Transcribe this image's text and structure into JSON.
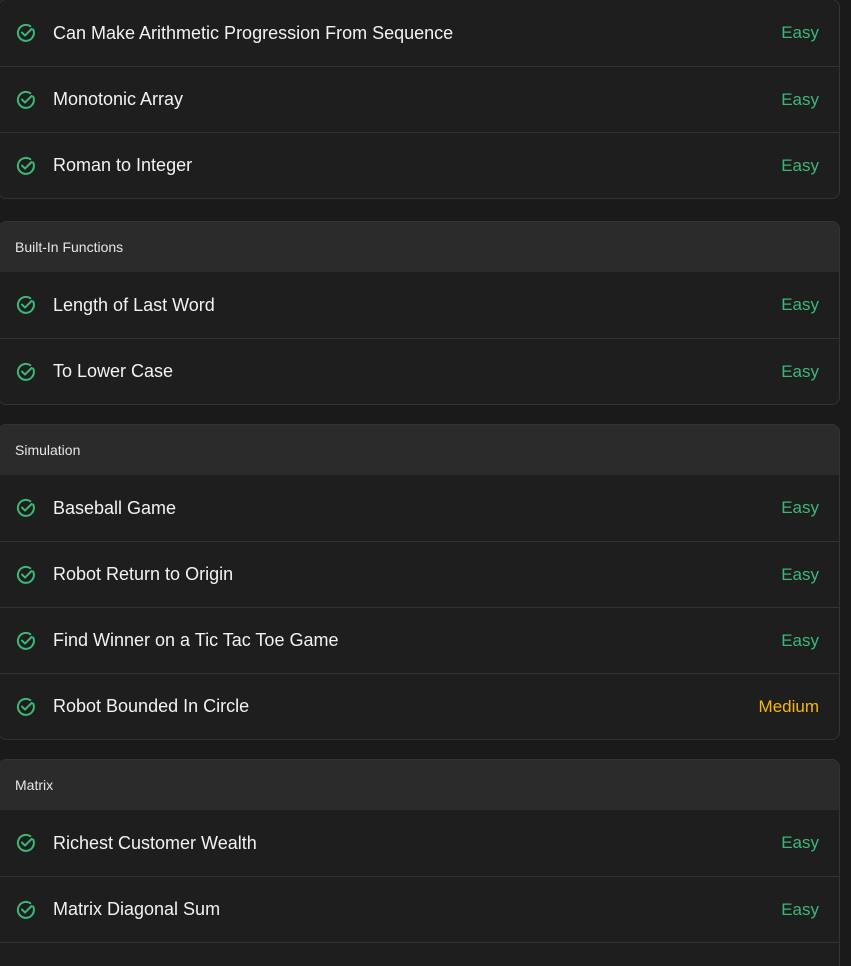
{
  "colors": {
    "easy": "#3cb776",
    "medium": "#f5b70f",
    "check": "#3cb776"
  },
  "sections": [
    {
      "header": "",
      "items": [
        {
          "title": "Can Make Arithmetic Progression From Sequence",
          "difficulty": "Easy",
          "icon": "check-circle-icon"
        },
        {
          "title": "Monotonic Array",
          "difficulty": "Easy",
          "icon": "check-circle-icon"
        },
        {
          "title": "Roman to Integer",
          "difficulty": "Easy",
          "icon": "check-circle-icon"
        }
      ]
    },
    {
      "header": "Built-In Functions",
      "items": [
        {
          "title": "Length of Last Word",
          "difficulty": "Easy",
          "icon": "check-circle-icon"
        },
        {
          "title": "To Lower Case",
          "difficulty": "Easy",
          "icon": "check-circle-icon"
        }
      ]
    },
    {
      "header": "Simulation",
      "items": [
        {
          "title": "Baseball Game",
          "difficulty": "Easy",
          "icon": "check-circle-icon"
        },
        {
          "title": "Robot Return to Origin",
          "difficulty": "Easy",
          "icon": "check-circle-icon"
        },
        {
          "title": "Find Winner on a Tic Tac Toe Game",
          "difficulty": "Easy",
          "icon": "check-circle-icon"
        },
        {
          "title": "Robot Bounded In Circle",
          "difficulty": "Medium",
          "icon": "check-circle-icon"
        }
      ]
    },
    {
      "header": "Matrix",
      "items": [
        {
          "title": "Richest Customer Wealth",
          "difficulty": "Easy",
          "icon": "check-circle-icon"
        },
        {
          "title": "Matrix Diagonal Sum",
          "difficulty": "Easy",
          "icon": "check-circle-icon"
        },
        {
          "title": "",
          "difficulty": "",
          "icon": "check-circle-icon"
        }
      ]
    }
  ]
}
